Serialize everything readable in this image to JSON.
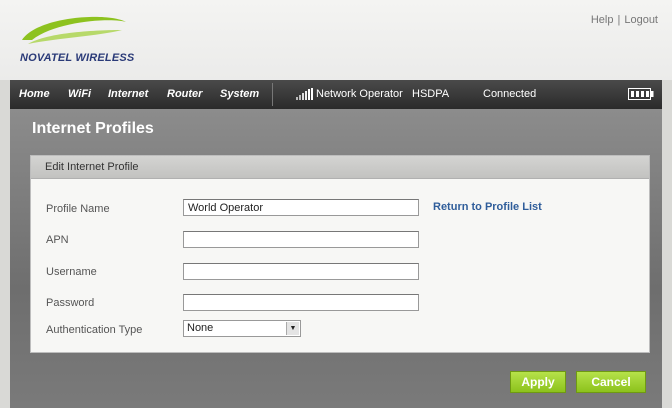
{
  "brand": {
    "name": "NOVATEL WIRELESS"
  },
  "top_links": {
    "help": "Help",
    "separator": "|",
    "logout": "Logout"
  },
  "nav": {
    "items": [
      "Home",
      "WiFi",
      "Internet",
      "Router",
      "System"
    ],
    "network_label": "Network Operator",
    "network_type": "HSDPA",
    "connection_status": "Connected",
    "signal_icon": "signal-bars-icon",
    "battery_icon": "battery-icon"
  },
  "page": {
    "title": "Internet Profiles",
    "panel_title": "Edit Internet Profile",
    "return_link": "Return to Profile List"
  },
  "form": {
    "profile_name": {
      "label": "Profile Name",
      "value": "World Operator"
    },
    "apn": {
      "label": "APN",
      "value": ""
    },
    "username": {
      "label": "Username",
      "value": ""
    },
    "password": {
      "label": "Password",
      "value": ""
    },
    "auth_type": {
      "label": "Authentication Type",
      "value": "None"
    }
  },
  "buttons": {
    "apply": "Apply",
    "cancel": "Cancel"
  },
  "colors": {
    "accent_green": "#8cc21c",
    "nav_bg": "#2a2a2a",
    "link_blue": "#2f5d9a",
    "logo_green": "#8dc21f"
  }
}
